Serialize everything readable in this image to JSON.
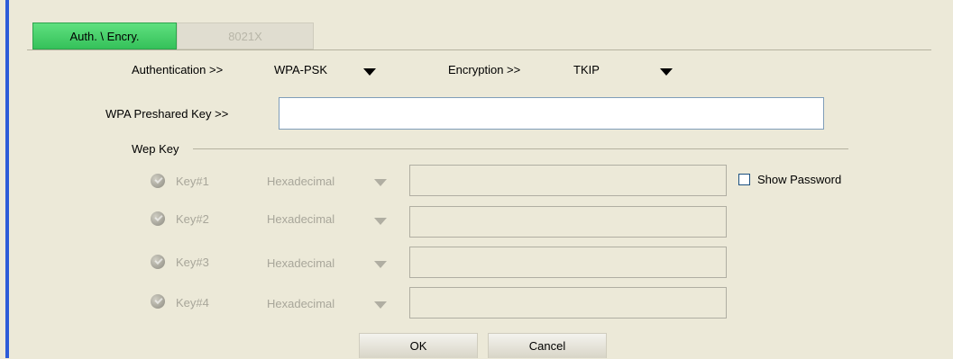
{
  "tabs": [
    {
      "label": "Auth. \\ Encry.",
      "active": true
    },
    {
      "label": "8021X",
      "active": false
    }
  ],
  "authentication": {
    "label": "Authentication >>",
    "value": "WPA-PSK"
  },
  "encryption": {
    "label": "Encryption >>",
    "value": "TKIP"
  },
  "wpa_key": {
    "label": "WPA Preshared Key >>",
    "value": ""
  },
  "wep": {
    "section_label": "Wep Key",
    "keys": [
      {
        "label": "Key#1",
        "format": "Hexadecimal",
        "value": ""
      },
      {
        "label": "Key#2",
        "format": "Hexadecimal",
        "value": ""
      },
      {
        "label": "Key#3",
        "format": "Hexadecimal",
        "value": ""
      },
      {
        "label": "Key#4",
        "format": "Hexadecimal",
        "value": ""
      }
    ],
    "show_password_label": "Show Password"
  },
  "buttons": {
    "ok": "OK",
    "cancel": "Cancel"
  },
  "colors": {
    "active_tab": "#35c15a",
    "left_bar": "#2c5bd8",
    "background": "#ece9d8"
  }
}
